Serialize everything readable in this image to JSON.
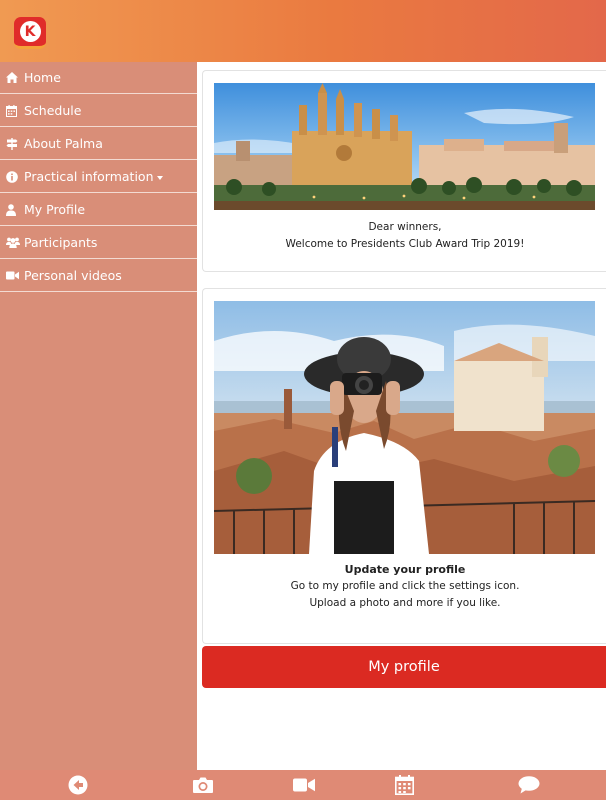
{
  "header": {
    "logo_letter": "K"
  },
  "sidebar": {
    "items": [
      {
        "label": "Home",
        "icon": "home-icon"
      },
      {
        "label": "Schedule",
        "icon": "calendar-icon"
      },
      {
        "label": "About Palma",
        "icon": "signpost-icon"
      },
      {
        "label": "Practical information",
        "icon": "info-icon"
      },
      {
        "label": "My Profile",
        "icon": "user-icon"
      },
      {
        "label": "Participants",
        "icon": "users-icon"
      },
      {
        "label": "Personal videos",
        "icon": "video-icon"
      }
    ]
  },
  "main": {
    "welcome_card": {
      "line1": "Dear winners,",
      "line2": "Welcome to Presidents Club Award Trip 2019!"
    },
    "profile_card": {
      "title": "Update your profile",
      "line1": "Go to my profile and click the settings icon.",
      "line2": "Upload a photo and more if you like."
    },
    "profile_button": "My profile"
  },
  "footer": {
    "icons": [
      "back-arrow-icon",
      "camera-icon",
      "video-icon",
      "calendar-icon",
      "chat-icon"
    ]
  },
  "colors": {
    "header_start": "#f09a52",
    "header_end": "#e3684a",
    "sidebar_bg": "#d98e78",
    "button_red": "#db2a22",
    "footer_bg": "#df8a75"
  }
}
